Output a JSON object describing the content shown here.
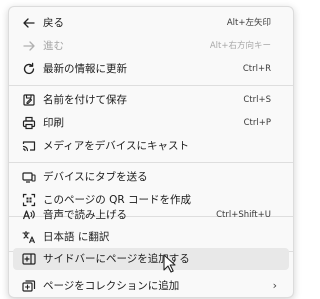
{
  "menu": {
    "items": [
      {
        "label": "戻る",
        "shortcut": "Alt+左矢印",
        "icon": "back-arrow-icon",
        "disabled": false
      },
      {
        "label": "進む",
        "shortcut": "Alt+右方向キー",
        "icon": "forward-arrow-icon",
        "disabled": true
      },
      {
        "label": "最新の情報に更新",
        "shortcut": "Ctrl+R",
        "icon": "refresh-icon",
        "disabled": false
      },
      {
        "label": "名前を付けて保存",
        "shortcut": "Ctrl+S",
        "icon": "save-as-icon",
        "disabled": false
      },
      {
        "label": "印刷",
        "shortcut": "Ctrl+P",
        "icon": "print-icon",
        "disabled": false
      },
      {
        "label": "メディアをデバイスにキャスト",
        "shortcut": "",
        "icon": "cast-icon",
        "disabled": false
      },
      {
        "label": "デバイスにタブを送る",
        "shortcut": "",
        "icon": "send-tab-icon",
        "disabled": false
      },
      {
        "label": "このページの QR コードを作成",
        "shortcut": "",
        "icon": "qr-code-icon",
        "disabled": false
      },
      {
        "label": "音声で読み上げる",
        "shortcut": "Ctrl+Shift+U",
        "icon": "read-aloud-icon",
        "disabled": false
      },
      {
        "label": "日本語 に翻訳",
        "shortcut": "",
        "icon": "translate-icon",
        "disabled": false
      },
      {
        "label": "サイドバーにページを追加する",
        "shortcut": "",
        "icon": "add-sidebar-icon",
        "disabled": false,
        "hovered": true
      },
      {
        "label": "ページをコレクションに追加",
        "shortcut": "",
        "icon": "collections-icon",
        "disabled": false,
        "submenu": "›"
      }
    ]
  }
}
